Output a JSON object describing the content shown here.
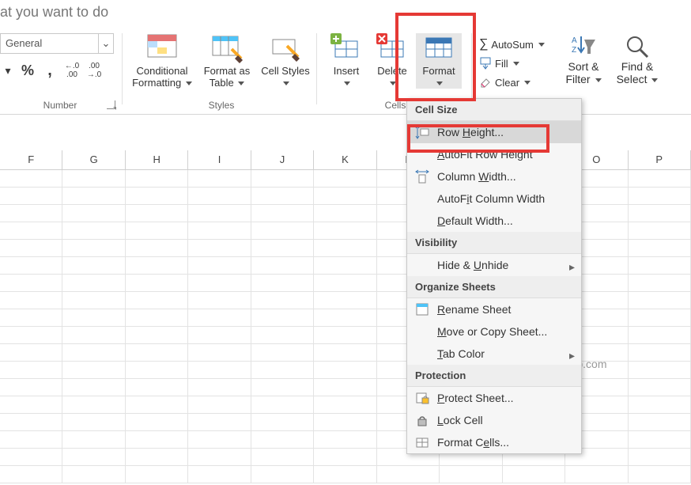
{
  "tell_me": "at you want to do",
  "number_group": {
    "label": "Number",
    "format": "General",
    "btn_percent": "%",
    "btn_comma": ",",
    "btn_decinc": ".00",
    "btn_decdec": ".00"
  },
  "styles_group": {
    "label": "Styles",
    "cond": "Conditional Formatting",
    "table": "Format as Table",
    "cell": "Cell Styles"
  },
  "cells_group": {
    "label": "Cells",
    "insert": "Insert",
    "delete": "Delete",
    "format": "Format"
  },
  "editing_group": {
    "autosum": "AutoSum",
    "fill": "Fill",
    "clear": "Clear",
    "sort": "Sort & Filter",
    "find": "Find & Select"
  },
  "columns": [
    "F",
    "G",
    "H",
    "I",
    "J",
    "K",
    "L",
    "",
    "",
    "O",
    "P"
  ],
  "menu": {
    "s1": "Cell Size",
    "row_h": "Row Height...",
    "autofit_r": "AutoFit Row Height",
    "col_w": "Column Width...",
    "autofit_c": "AutoFit Column Width",
    "def_w": "Default Width...",
    "s2": "Visibility",
    "hide": "Hide & Unhide",
    "s3": "Organize Sheets",
    "rename": "Rename Sheet",
    "move": "Move or Copy Sheet...",
    "tab": "Tab Color",
    "s4": "Protection",
    "protect": "Protect Sheet...",
    "lock": "Lock Cell",
    "cells": "Format Cells..."
  },
  "watermark": "MyWindowsHub.com"
}
